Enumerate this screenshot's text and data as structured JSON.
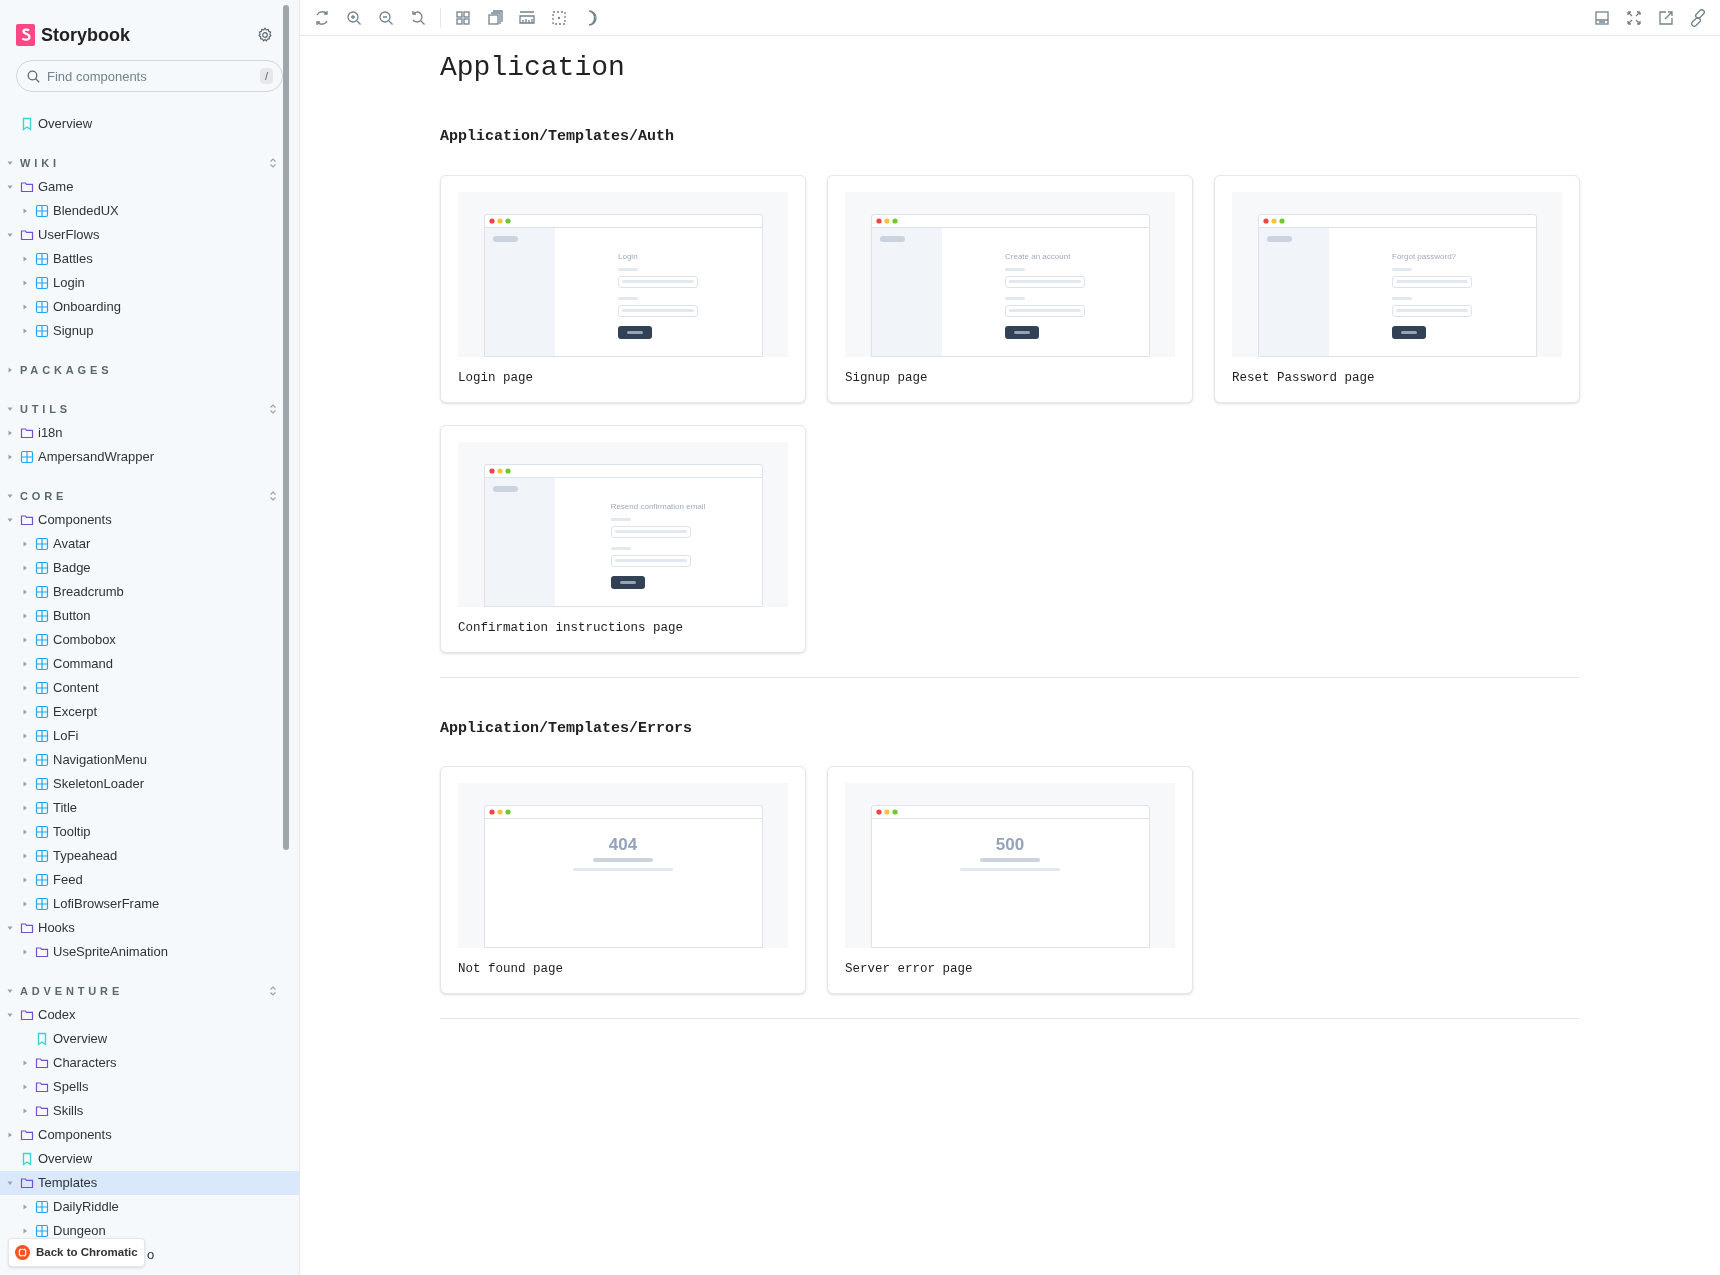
{
  "sidebar": {
    "brand": "Storybook",
    "search": {
      "placeholder": "Find components",
      "shortcut": "/"
    },
    "tree": [
      {
        "kind": "doc",
        "label": "Overview",
        "selected": false
      },
      {
        "kind": "section",
        "label": "WIKI",
        "expanded": true,
        "toggle": true,
        "children": [
          {
            "kind": "folder",
            "label": "Game",
            "expanded": true,
            "selected": false,
            "children": [
              {
                "kind": "component",
                "label": "BlendedUX",
                "expanded": false,
                "selected": false
              }
            ]
          },
          {
            "kind": "folder",
            "label": "UserFlows",
            "expanded": true,
            "selected": false,
            "children": [
              {
                "kind": "component",
                "label": "Battles",
                "expanded": false,
                "selected": false
              },
              {
                "kind": "component",
                "label": "Login",
                "expanded": false,
                "selected": false
              },
              {
                "kind": "component",
                "label": "Onboarding",
                "expanded": false,
                "selected": false
              },
              {
                "kind": "component",
                "label": "Signup",
                "expanded": false,
                "selected": false
              }
            ]
          }
        ]
      },
      {
        "kind": "section",
        "label": "PACKAGES",
        "expanded": false,
        "toggle": false
      },
      {
        "kind": "section",
        "label": "UTILS",
        "expanded": true,
        "toggle": true,
        "children": [
          {
            "kind": "folder",
            "label": "i18n",
            "expanded": false,
            "selected": false
          },
          {
            "kind": "component",
            "label": "AmpersandWrapper",
            "expanded": false,
            "selected": false
          }
        ]
      },
      {
        "kind": "section",
        "label": "CORE",
        "expanded": true,
        "toggle": true,
        "children": [
          {
            "kind": "folder",
            "label": "Components",
            "expanded": true,
            "selected": false,
            "children": [
              {
                "kind": "component",
                "label": "Avatar",
                "expanded": false,
                "selected": false
              },
              {
                "kind": "component",
                "label": "Badge",
                "expanded": false,
                "selected": false
              },
              {
                "kind": "component",
                "label": "Breadcrumb",
                "expanded": false,
                "selected": false
              },
              {
                "kind": "component",
                "label": "Button",
                "expanded": false,
                "selected": false
              },
              {
                "kind": "component",
                "label": "Combobox",
                "expanded": false,
                "selected": false
              },
              {
                "kind": "component",
                "label": "Command",
                "expanded": false,
                "selected": false
              },
              {
                "kind": "component",
                "label": "Content",
                "expanded": false,
                "selected": false
              },
              {
                "kind": "component",
                "label": "Excerpt",
                "expanded": false,
                "selected": false
              },
              {
                "kind": "component",
                "label": "LoFi",
                "expanded": false,
                "selected": false
              },
              {
                "kind": "component",
                "label": "NavigationMenu",
                "expanded": false,
                "selected": false
              },
              {
                "kind": "component",
                "label": "SkeletonLoader",
                "expanded": false,
                "selected": false
              },
              {
                "kind": "component",
                "label": "Title",
                "expanded": false,
                "selected": false
              },
              {
                "kind": "component",
                "label": "Tooltip",
                "expanded": false,
                "selected": false
              },
              {
                "kind": "component",
                "label": "Typeahead",
                "expanded": false,
                "selected": false
              },
              {
                "kind": "component",
                "label": "Feed",
                "expanded": false,
                "selected": false
              },
              {
                "kind": "component",
                "label": "LofiBrowserFrame",
                "expanded": false,
                "selected": false
              }
            ]
          },
          {
            "kind": "folder",
            "label": "Hooks",
            "expanded": true,
            "selected": false,
            "children": [
              {
                "kind": "folder",
                "label": "UseSpriteAnimation",
                "expanded": false,
                "selected": false
              }
            ]
          }
        ]
      },
      {
        "kind": "section",
        "label": "ADVENTURE",
        "expanded": true,
        "toggle": true,
        "children": [
          {
            "kind": "folder",
            "label": "Codex",
            "expanded": true,
            "selected": false,
            "children": [
              {
                "kind": "doc",
                "label": "Overview",
                "selected": false
              },
              {
                "kind": "folder",
                "label": "Characters",
                "expanded": false,
                "selected": false
              },
              {
                "kind": "folder",
                "label": "Spells",
                "expanded": false,
                "selected": false
              },
              {
                "kind": "folder",
                "label": "Skills",
                "expanded": false,
                "selected": false
              }
            ]
          },
          {
            "kind": "folder",
            "label": "Components",
            "expanded": false,
            "selected": false
          },
          {
            "kind": "doc",
            "label": "Overview",
            "selected": false
          },
          {
            "kind": "folder",
            "label": "Templates",
            "expanded": true,
            "selected": true,
            "children": [
              {
                "kind": "component",
                "label": "DailyRiddle",
                "expanded": false,
                "selected": false
              },
              {
                "kind": "component",
                "label": "Dungeon",
                "expanded": false,
                "selected": false
              },
              {
                "kind": "covered",
                "label": "o",
                "selected": false
              }
            ]
          }
        ]
      }
    ],
    "badge": "Back to Chromatic"
  },
  "main": {
    "title": "Application",
    "sections": [
      {
        "title": "Application/Templates/Auth",
        "stories": [
          {
            "label": "Login page",
            "preview": {
              "kind": "form",
              "heading": "Login"
            }
          },
          {
            "label": "Signup page",
            "preview": {
              "kind": "form",
              "heading": "Create an account"
            }
          },
          {
            "label": "Reset Password page",
            "preview": {
              "kind": "form",
              "heading": "Forgot password?"
            }
          },
          {
            "label": "Confirmation instructions page",
            "preview": {
              "kind": "form",
              "heading": "Resend confirmation email"
            }
          }
        ]
      },
      {
        "title": "Application/Templates/Errors",
        "stories": [
          {
            "label": "Not found page",
            "preview": {
              "kind": "error",
              "code": "404"
            }
          },
          {
            "label": "Server error page",
            "preview": {
              "kind": "error",
              "code": "500"
            }
          }
        ]
      }
    ]
  }
}
